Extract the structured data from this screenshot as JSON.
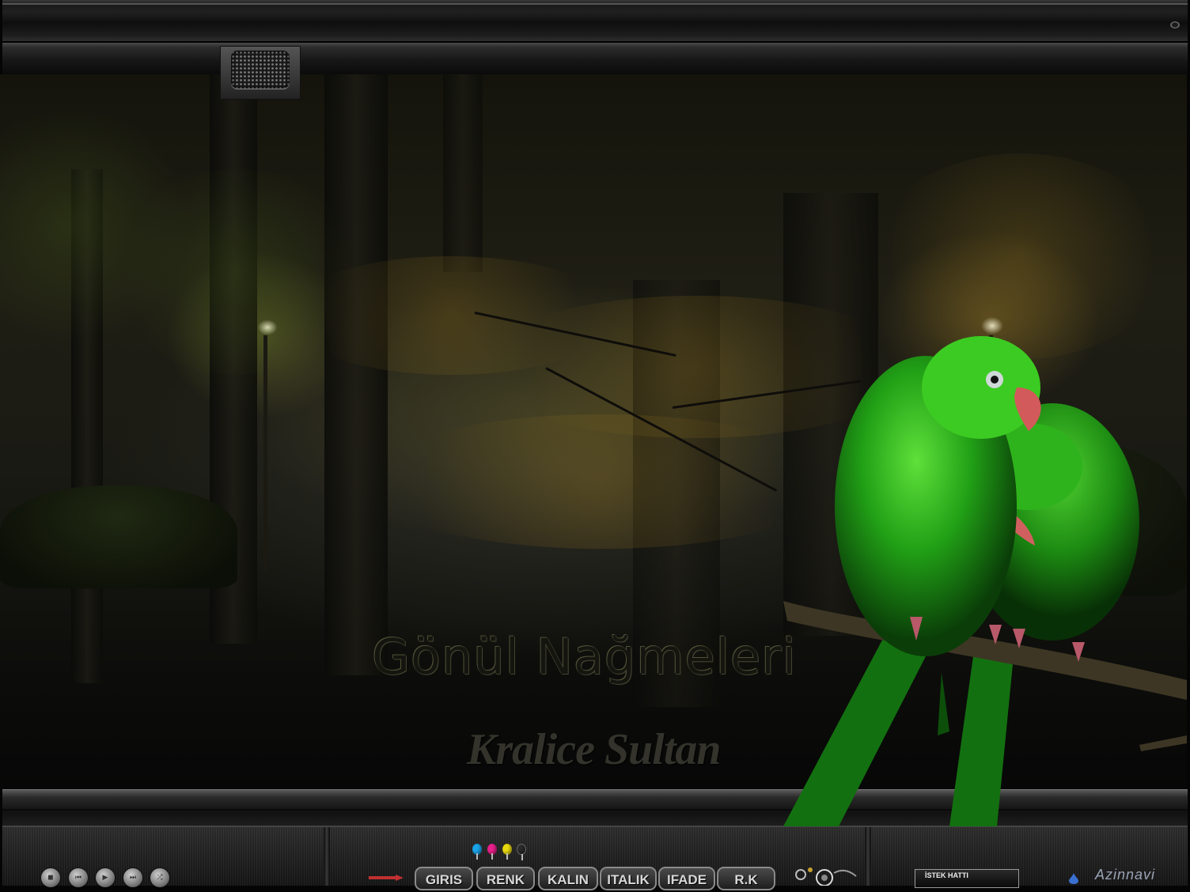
{
  "window": {
    "close_icon": "close-dot-icon"
  },
  "toolbar": {
    "grip_icon": "mesh-grip-icon"
  },
  "scene": {
    "title": "Gönül Nağmeleri",
    "subtitle": "Kralice Sultan",
    "image_subject": "two green parrots on a branch in a night park"
  },
  "player": {
    "buttons": [
      {
        "icon": "stop-icon",
        "glyph": "◼"
      },
      {
        "icon": "previous-icon",
        "glyph": "⏮"
      },
      {
        "icon": "play-icon",
        "glyph": "▶"
      },
      {
        "icon": "next-icon",
        "glyph": "⏭"
      },
      {
        "icon": "shuffle-icon",
        "glyph": "⤮"
      }
    ]
  },
  "chat": {
    "colors": [
      "#1aa3e8",
      "#e8208a",
      "#e8d80e",
      "#2a2a2a"
    ],
    "buttons": [
      "GIRIS",
      "RENK",
      "KALIN",
      "ITALIK",
      "IFADE",
      "R.K"
    ],
    "request_line": "İSTEK HATTI",
    "logo": "Azinnavi"
  }
}
